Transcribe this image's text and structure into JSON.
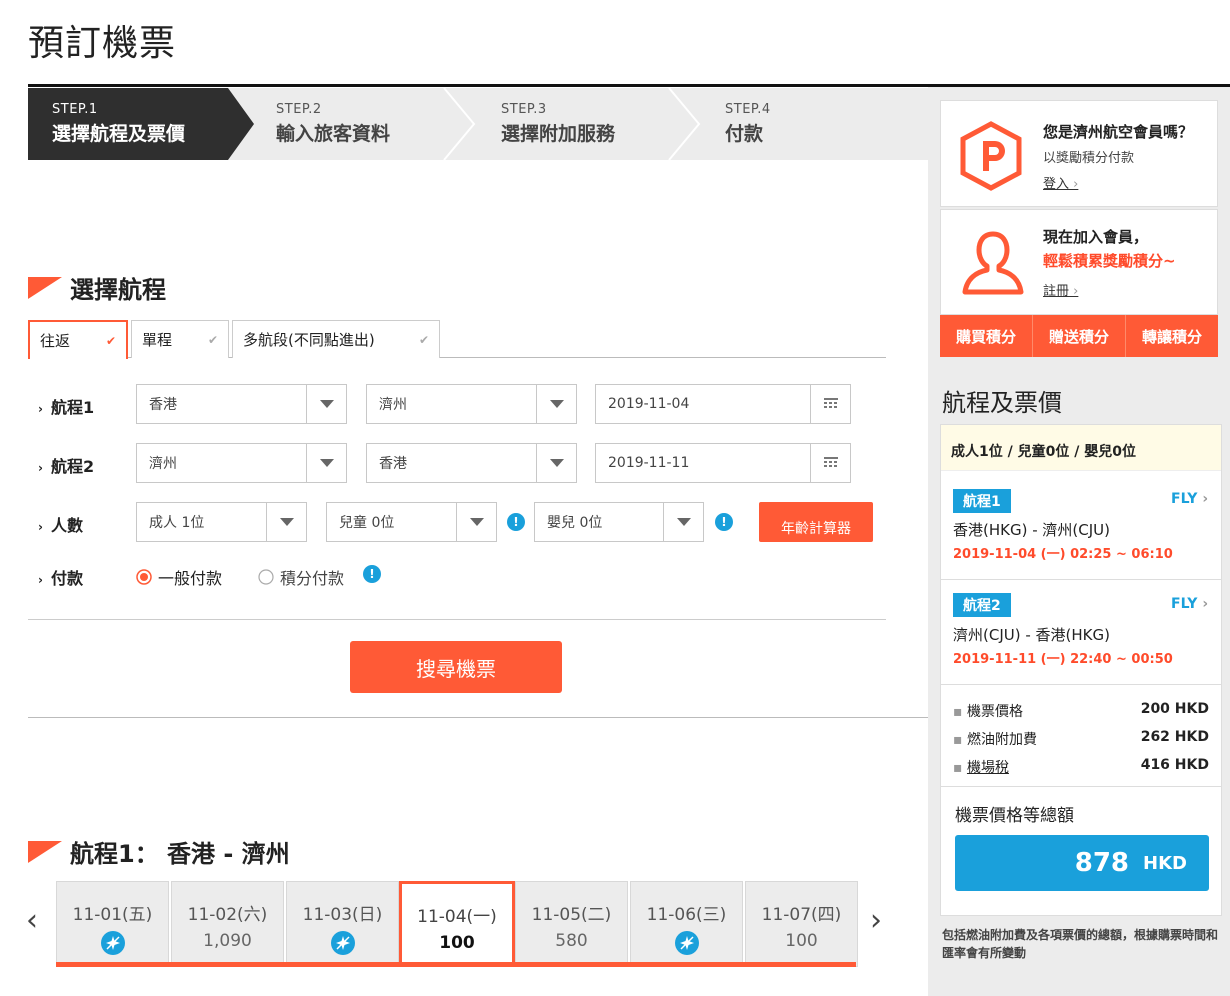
{
  "page": {
    "title": "預訂機票"
  },
  "steps": [
    {
      "num": "STEP.1",
      "label": "選擇航程及票價",
      "active": true
    },
    {
      "num": "STEP.2",
      "label": "輸入旅客資料",
      "active": false
    },
    {
      "num": "STEP.3",
      "label": "選擇附加服務",
      "active": false
    },
    {
      "num": "STEP.4",
      "label": "付款",
      "active": false
    }
  ],
  "select_route": {
    "title": "選擇航程",
    "tabs": [
      "往返",
      "單程",
      "多航段(不同點進出)"
    ],
    "selected_tab": "往返",
    "leg1": {
      "label": "航程1",
      "from": "香港",
      "to": "濟州",
      "date": "2019-11-04"
    },
    "leg2": {
      "label": "航程2",
      "from": "濟州",
      "to": "香港",
      "date": "2019-11-11"
    },
    "pax": {
      "label": "人數",
      "adult": "成人 1位",
      "child": "兒童 0位",
      "infant": "嬰兒 0位",
      "age_calc": "年齡計算器"
    },
    "payment": {
      "label": "付款",
      "opt1": "一般付款",
      "opt2": "積分付款",
      "selected": "一般付款"
    },
    "search": "搜尋機票"
  },
  "flight1": {
    "title": "航程1： 香港 - 濟州",
    "dates": [
      {
        "date": "11-01(五)",
        "price": null
      },
      {
        "date": "11-02(六)",
        "price": "1,090"
      },
      {
        "date": "11-03(日)",
        "price": null
      },
      {
        "date": "11-04(一)",
        "price": "100",
        "selected": true
      },
      {
        "date": "11-05(二)",
        "price": "580"
      },
      {
        "date": "11-06(三)",
        "price": null
      },
      {
        "date": "11-07(四)",
        "price": "100"
      }
    ]
  },
  "sidebar": {
    "member_q": "您是濟州航空會員嗎？",
    "member_sub": "以獎勵積分付款",
    "login": "登入",
    "join": "現在加入會員，",
    "join_sub": "輕鬆積累獎勵積分~",
    "register": "註冊",
    "buttons": [
      "購買積分",
      "贈送積分",
      "轉讓積分"
    ],
    "summary_title": "航程及票價",
    "pax_summary": "成人1位 / 兒童0位 / 嬰兒0位",
    "leg1": {
      "badge": "航程1",
      "fly": "FLY",
      "route": "香港(HKG) - 濟州(CJU)",
      "time": "2019-11-04 (一) 02:25 ~ 06:10"
    },
    "leg2": {
      "badge": "航程2",
      "fly": "FLY",
      "route": "濟州(CJU) - 香港(HKG)",
      "time": "2019-11-11 (一) 22:40 ~ 00:50"
    },
    "prices": [
      {
        "label": "機票價格",
        "value": "200 HKD"
      },
      {
        "label": "燃油附加費",
        "value": "262 HKD"
      },
      {
        "label": "機場稅",
        "value": "416 HKD"
      }
    ],
    "total_label": "機票價格等總額",
    "total_value": "878",
    "total_currency": "HKD",
    "note": "包括燃油附加費及各項票價的總額，根據購票時間和匯率會有所變動"
  },
  "colors": {
    "accent": "#ff5a36",
    "blue": "#1aa0db",
    "dark": "#2f2f2f"
  }
}
